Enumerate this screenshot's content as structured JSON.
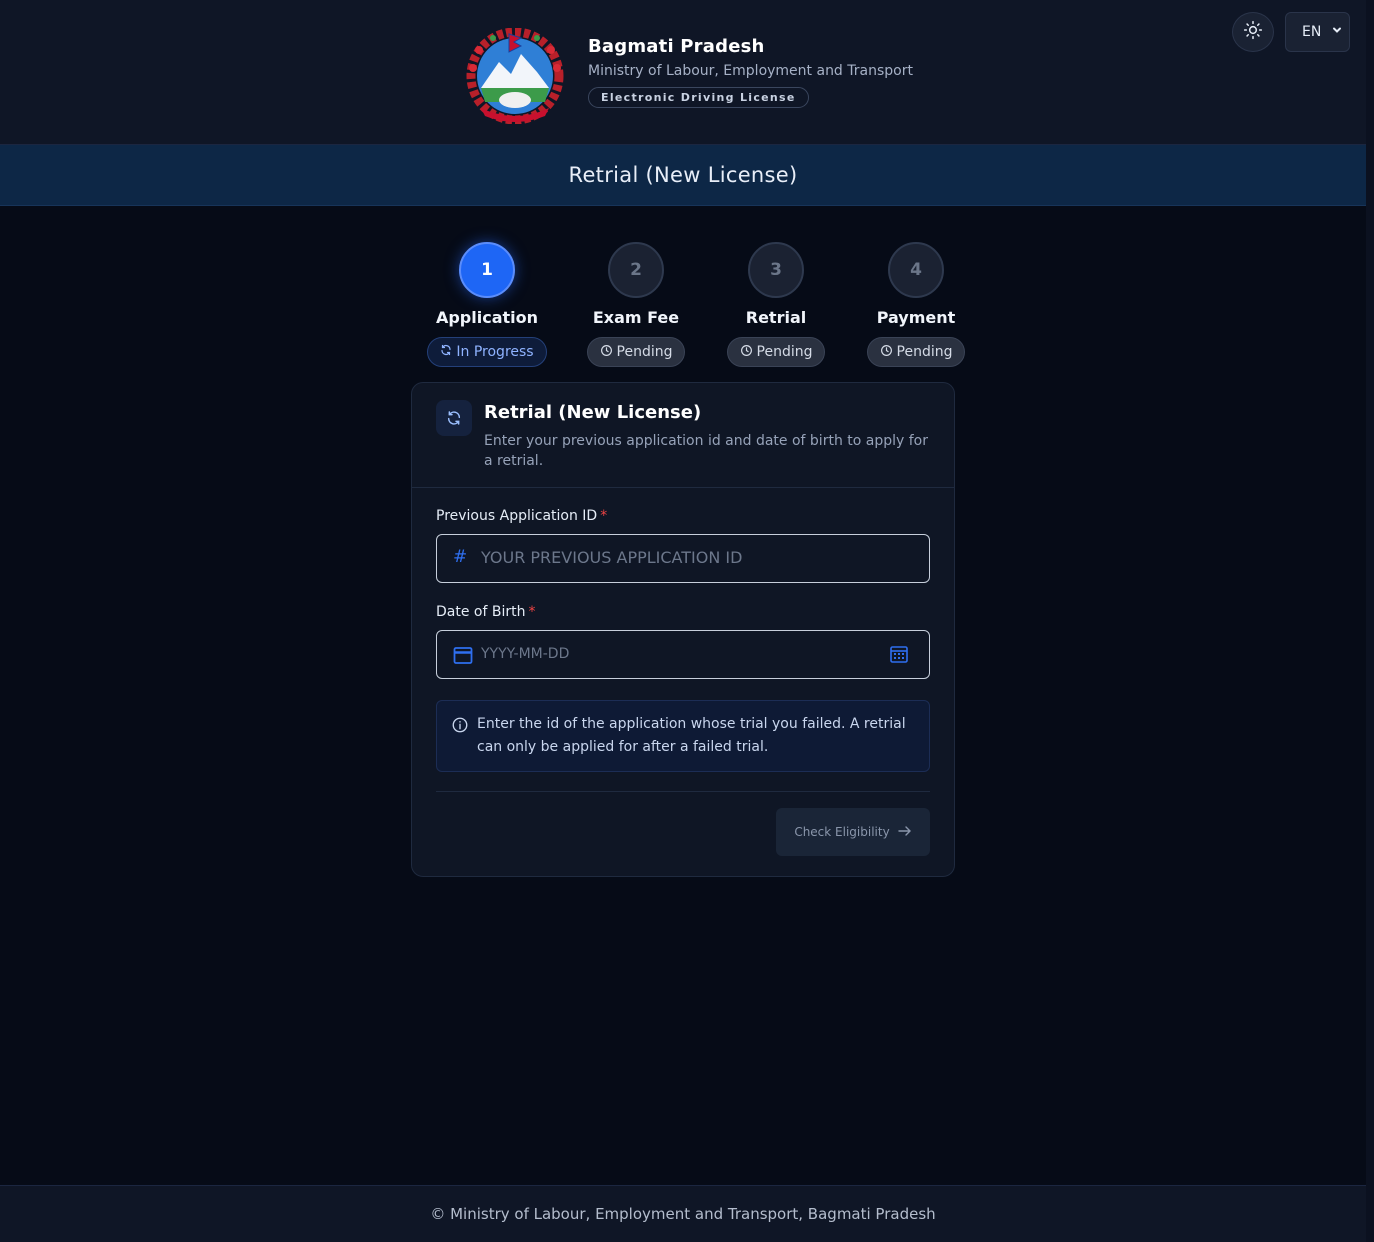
{
  "header": {
    "title": "Bagmati Pradesh",
    "subtitle": "Ministry of Labour, Employment and Transport",
    "badge": "Electronic Driving License",
    "language": "EN"
  },
  "banner": {
    "title": "Retrial (New License)"
  },
  "steps": [
    {
      "number": "1",
      "label": "Application",
      "status": "In Progress",
      "active": true
    },
    {
      "number": "2",
      "label": "Exam Fee",
      "status": "Pending",
      "active": false
    },
    {
      "number": "3",
      "label": "Retrial",
      "status": "Pending",
      "active": false
    },
    {
      "number": "4",
      "label": "Payment",
      "status": "Pending",
      "active": false
    }
  ],
  "card": {
    "title": "Retrial (New License)",
    "description": "Enter your previous application id and date of birth to apply for a retrial.",
    "fields": {
      "app_id": {
        "label": "Previous Application ID",
        "required_mark": "*",
        "placeholder": "YOUR PREVIOUS APPLICATION ID",
        "prefix": "#"
      },
      "dob": {
        "label": "Date of Birth",
        "required_mark": "*",
        "placeholder": "YYYY-MM-DD"
      }
    },
    "info": "Enter the id of the application whose trial you failed. A retrial can only be applied for after a failed trial.",
    "button": "Check Eligibility"
  },
  "footer": {
    "text": "© Ministry of Labour, Employment and Transport, Bagmati Pradesh"
  },
  "colors": {
    "accent": "#1e66f5",
    "background": "#060b17",
    "surface": "#0f1625",
    "required": "#ef4444"
  }
}
